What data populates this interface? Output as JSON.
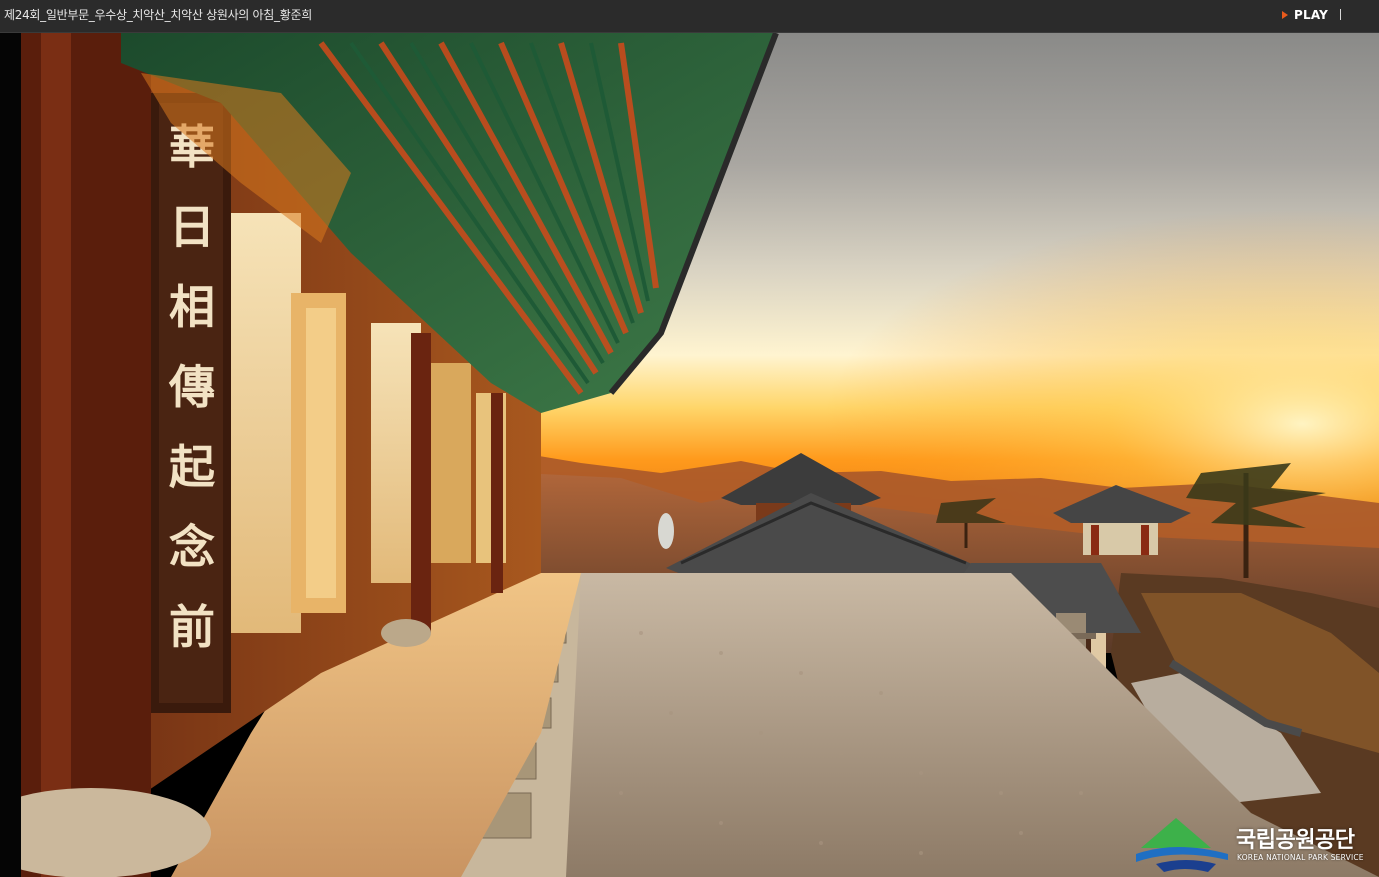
{
  "window": {
    "title": "제24회_일반부문_우수상_치악산_치악산 상원사의 아침_황준희"
  },
  "controls": {
    "play_label": "PLAY",
    "play_icon": "play-triangle-icon",
    "accent_color": "#e85a1c"
  },
  "photo": {
    "watermark_org_korean": "국립공원공단",
    "watermark_org_english": "KOREA NATIONAL PARK SERVICE"
  }
}
